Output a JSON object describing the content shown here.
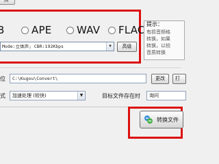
{
  "top_button": {
    "label": "浏"
  },
  "formats": {
    "partial_label": "B",
    "items": [
      {
        "label": "APE",
        "selected": false
      },
      {
        "label": "WAV",
        "selected": false
      },
      {
        "label": "FLAC",
        "selected": false
      }
    ]
  },
  "quality": {
    "value": "Mode:立体声; CBR:192Kbps",
    "advanced_label": "高级"
  },
  "tip": {
    "title": "提示：",
    "lines": [
      "有损音频格",
      "转换，如果",
      "转换，以较",
      "音质转换"
    ]
  },
  "output": {
    "label": "位",
    "path": "C:\\Kugou\\Convert\\",
    "change_label": "更改",
    "open_label": "打"
  },
  "mode": {
    "label": "式",
    "value": "加速处理 (较快)",
    "exists_label": "目标文件存在时",
    "exists_value": "询问"
  },
  "start": {
    "label": "转换文件",
    "icon": "convert-icon"
  },
  "colors": {
    "highlight": "#dd0f0f",
    "background": "#f0f0f0"
  }
}
